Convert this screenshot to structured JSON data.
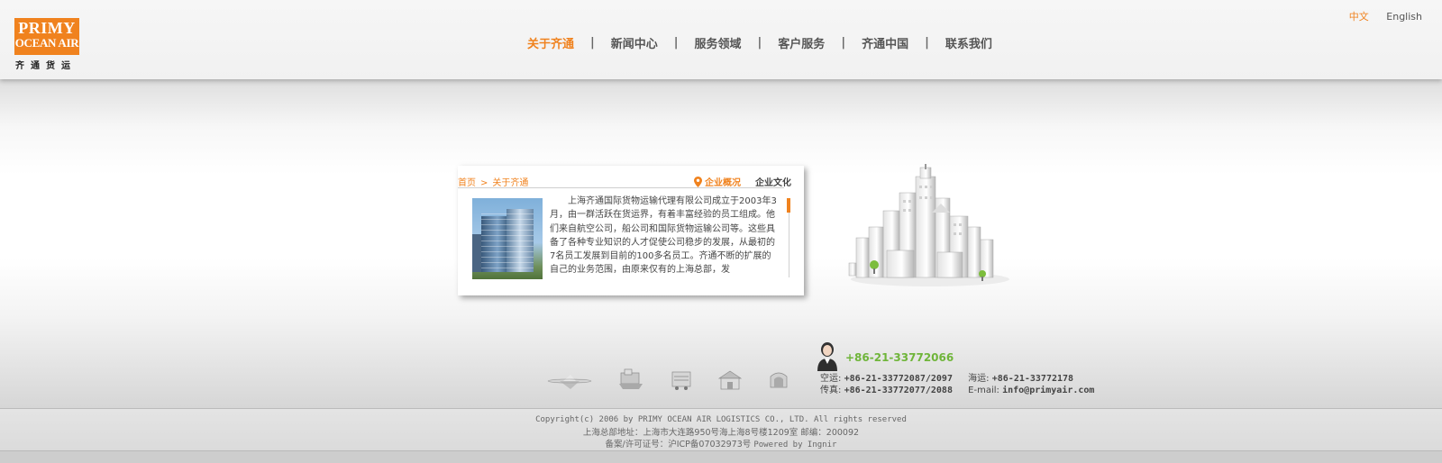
{
  "logo": {
    "line1": "PRIMY",
    "line2": "OCEAN AIR",
    "sub": "齐通货运"
  },
  "lang": {
    "zh": "中文",
    "en": "English"
  },
  "nav": {
    "items": [
      "关于齐通",
      "新闻中心",
      "服务领域",
      "客户服务",
      "齐通中国",
      "联系我们"
    ],
    "separator": "|"
  },
  "panel": {
    "breadcrumb_home": "首页",
    "breadcrumb_sep": ">",
    "breadcrumb_current": "关于齐通",
    "tab_active": "企业概况",
    "tab_other": "企业文化",
    "text": "上海齐通国际货物运输代理有限公司成立于2003年3月，由一群活跃在货运界，有着丰富经验的员工组成。他们来自航空公司，船公司和国际货物运输公司等。这些具备了各种专业知识的人才促使公司稳步的发展，从最初的7名员工发展到目前的100多名员工。齐通不断的扩展的自己的业务范围，由原来仅有的上海总部，发"
  },
  "contact": {
    "main_phone": "+86-21-33772066",
    "air_label": "空运:",
    "air_phone": "+86-21-33772087/2097",
    "sea_label": "海运:",
    "sea_phone": "+86-21-33772178",
    "fax_label": "传真:",
    "fax_phone": "+86-21-33772077/2088",
    "email_label": "E-mail:",
    "email": "info@primyair.com"
  },
  "footer": {
    "copyright": "Copyright(c) 2006 by PRIMY OCEAN AIR LOGISTICS CO., LTD. All rights reserved",
    "address": "上海总部地址：上海市大连路950号海上海8号楼1209室 邮编：200092",
    "icp_prefix": "备案/许可证号：",
    "icp": "沪ICP备07032973号",
    "powered": "Powered by Ingnir"
  },
  "colors": {
    "accent": "#f0821e",
    "green": "#6fb53a"
  },
  "icons": [
    "airplane-icon",
    "ship-icon",
    "truck-icon",
    "warehouse-icon",
    "customs-icon"
  ]
}
